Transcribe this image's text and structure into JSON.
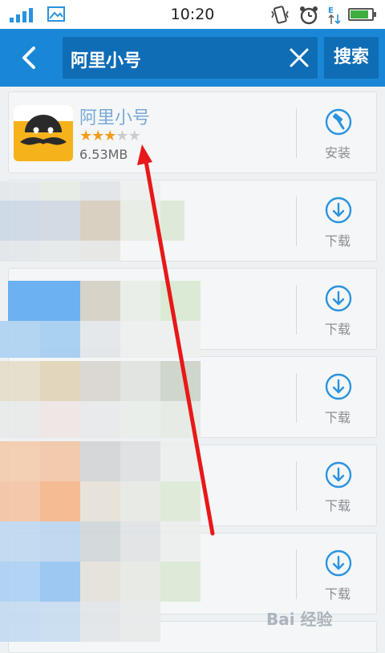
{
  "status_bar": {
    "time": "10:20",
    "icons": [
      "signal-icon",
      "gallery-icon",
      "vibrate-icon",
      "alarm-icon",
      "data-transfer-icon",
      "battery-charging-icon"
    ]
  },
  "header": {
    "back_icon": "back-arrow-icon",
    "search_value": "阿里小号",
    "clear_icon": "close-icon",
    "search_button": "搜索"
  },
  "results": [
    {
      "name": "阿里小号",
      "rating": 3,
      "max_rating": 5,
      "size": "6.53MB",
      "action": "安装",
      "action_icon": "install-hammer-icon"
    },
    {
      "action": "下载",
      "action_icon": "download-icon"
    },
    {
      "action": "下载",
      "action_icon": "download-icon"
    },
    {
      "action": "下载",
      "action_icon": "download-icon"
    },
    {
      "action": "下载",
      "action_icon": "download-icon"
    },
    {
      "action": "下载",
      "action_icon": "download-icon"
    }
  ],
  "watermark": "Bai 经验",
  "colors": {
    "header": "#1a87d6",
    "search_box": "#0f6db6",
    "accent_icon": "#2a93df",
    "star_on": "#f29c1c",
    "arrow": "#e81818"
  }
}
